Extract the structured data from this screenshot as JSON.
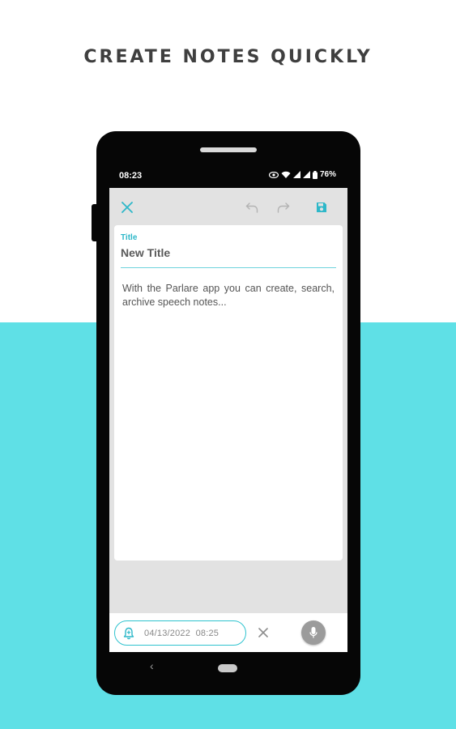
{
  "headline": "CREATE NOTES QUICKLY",
  "colors": {
    "accent": "#2eb8c9",
    "bottom_background": "#5fe0e6",
    "phone_body": "#060606",
    "screen_background": "#e2e2e2"
  },
  "status_bar": {
    "time": "08:23",
    "battery": "76%",
    "icons": [
      "eye-icon",
      "wifi-icon",
      "signal-icon",
      "signal-icon",
      "battery-icon"
    ]
  },
  "toolbar": {
    "close_icon": "close-icon",
    "undo_icon": "undo-icon",
    "redo_icon": "redo-icon",
    "save_icon": "save-icon"
  },
  "note": {
    "title_label": "Title",
    "title_value": "New Title",
    "body": "With the Parlare app you can create, search, archive speech notes..."
  },
  "bottom_bar": {
    "reminder_icon": "bell-icon",
    "reminder_datetime": "04/13/2022  08:25",
    "clear_icon": "close-icon",
    "mic_icon": "mic-icon"
  },
  "navigation": {
    "back_glyph": "‹"
  }
}
